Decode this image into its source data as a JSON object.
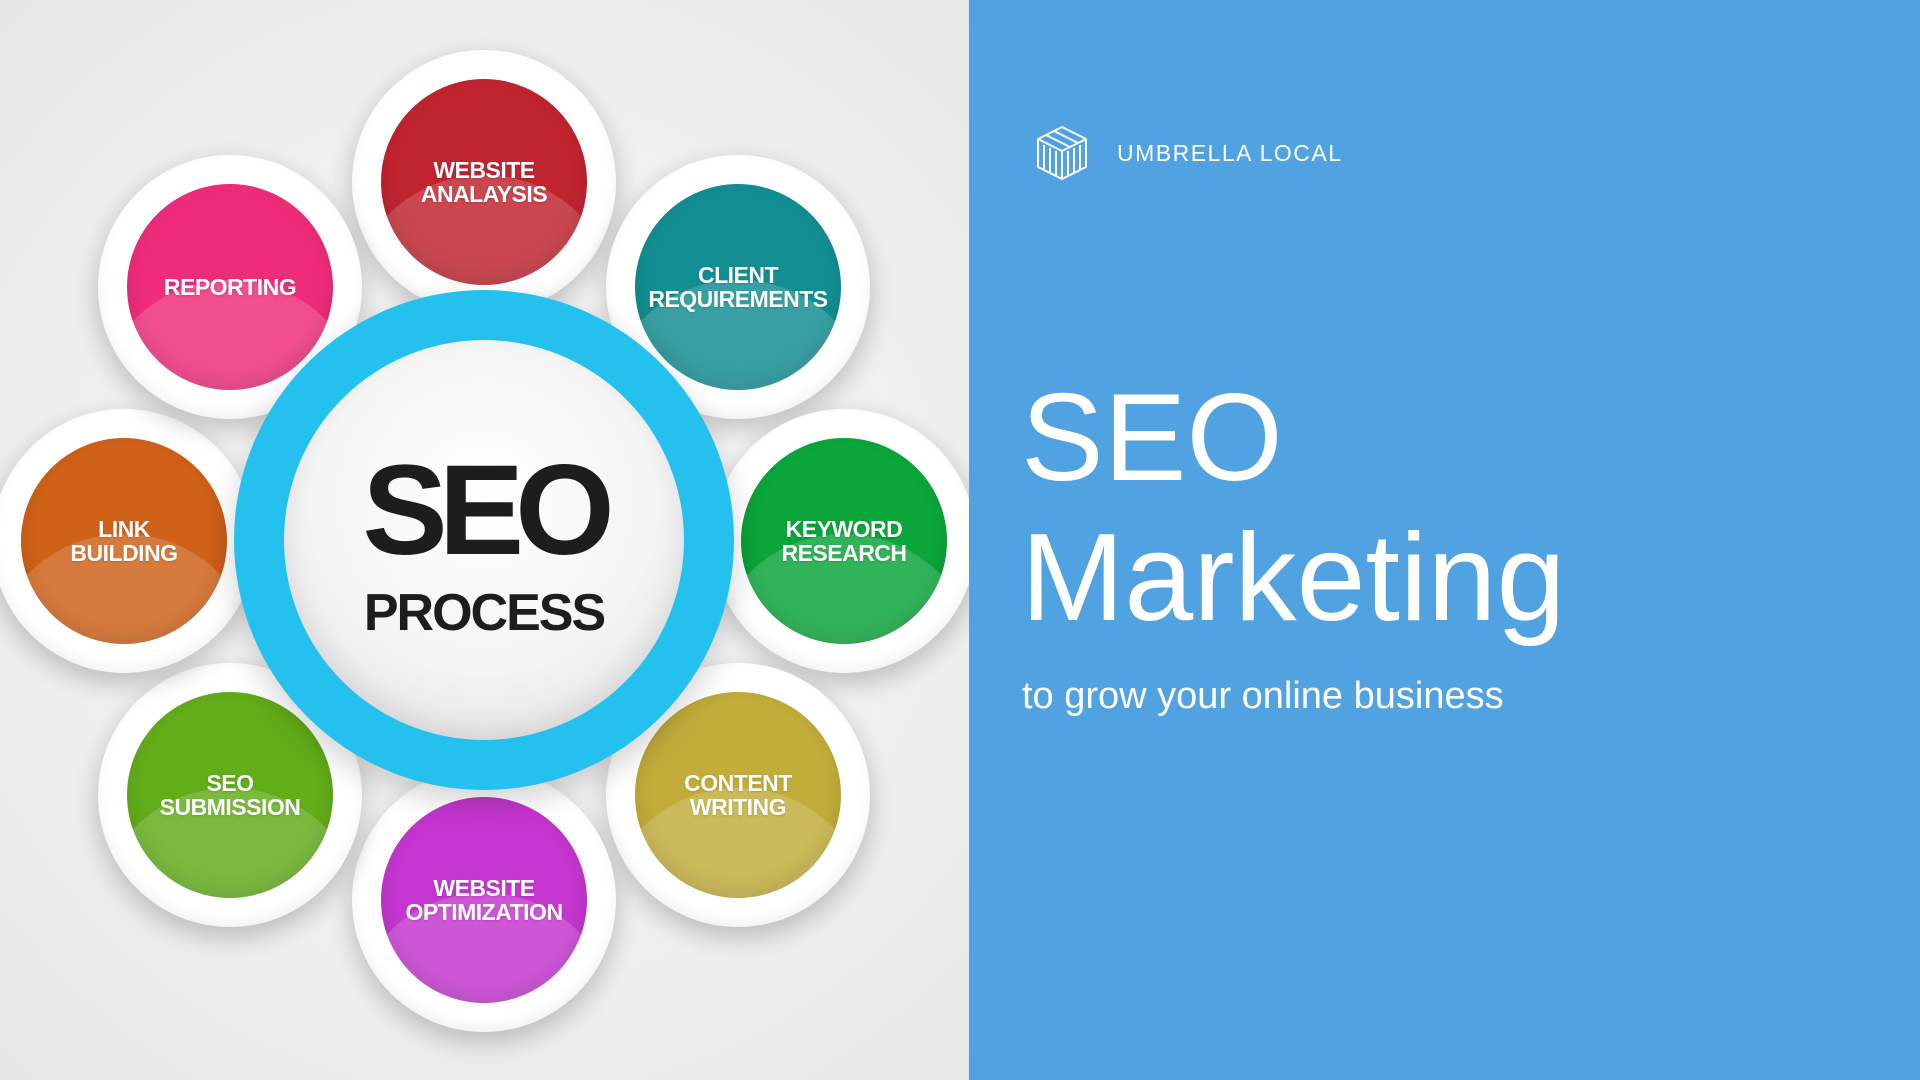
{
  "diagram": {
    "center_title": "SEO",
    "center_subtitle": "PROCESS",
    "petals": [
      {
        "label": "WEBSITE\nANALAYSIS",
        "color": "#c0242f"
      },
      {
        "label": "CLIENT\nREQUIREMENTS",
        "color": "#128e93"
      },
      {
        "label": "KEYWORD\nRESEARCH",
        "color": "#0aa63a"
      },
      {
        "label": "CONTENT\nWRITING",
        "color": "#c2ad3a"
      },
      {
        "label": "WEBSITE\nOPTIMIZATION",
        "color": "#c436cf"
      },
      {
        "label": "SEO\nSUBMISSION",
        "color": "#62ad1a"
      },
      {
        "label": "LINK\nBUILDING",
        "color": "#d06118"
      },
      {
        "label": "REPORTING",
        "color": "#ef2c7a"
      }
    ],
    "ring_color": "#24c0ee"
  },
  "brand": {
    "name": "UMBRELLA LOCAL",
    "logo_icon": "cube-logo-icon"
  },
  "headline": {
    "line1": "SEO",
    "line2": "Marketing"
  },
  "tagline": "to grow your online business",
  "colors": {
    "accent_background": "#50a3e0"
  }
}
